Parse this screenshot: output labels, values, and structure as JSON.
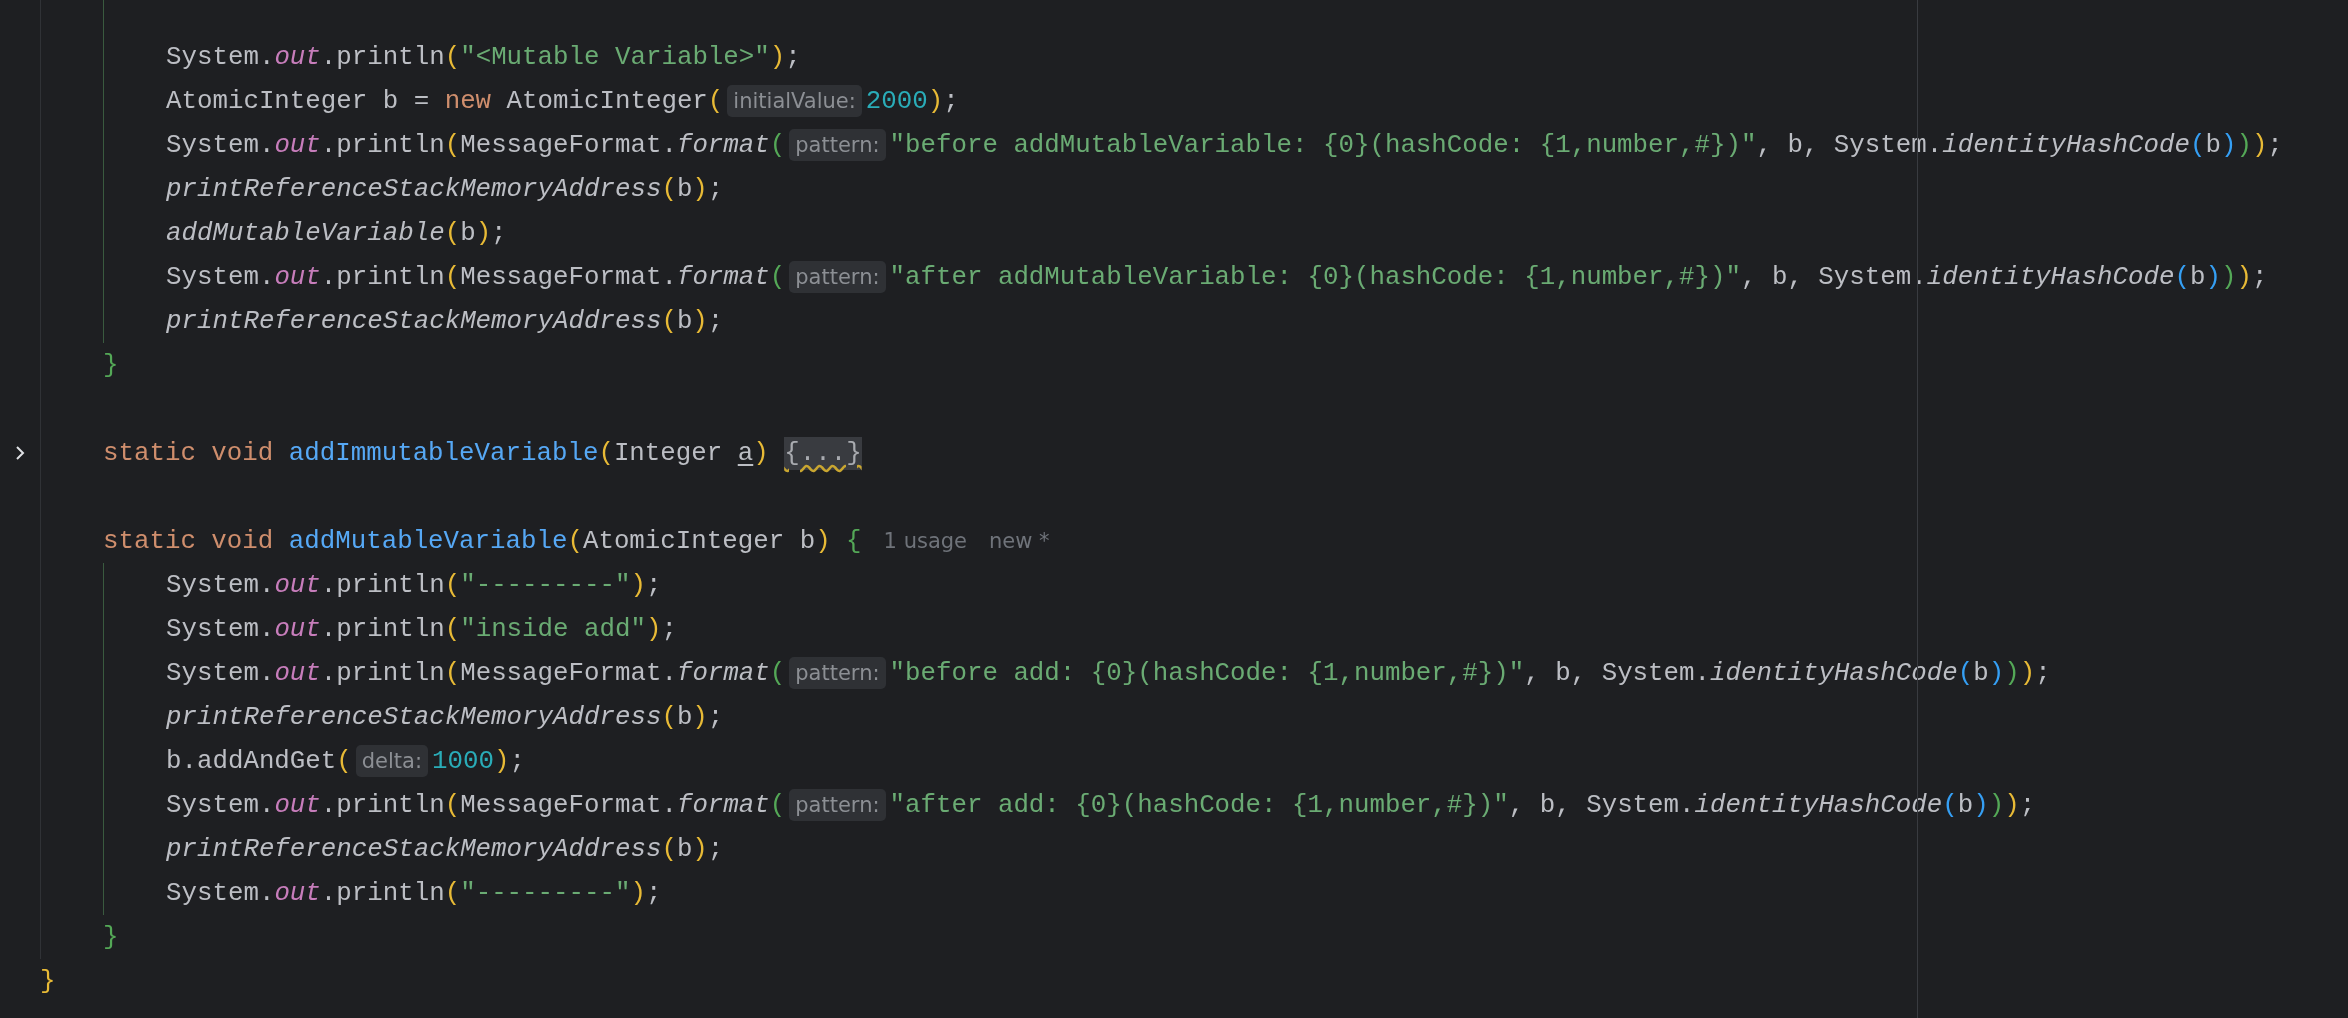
{
  "code": [
    {
      "children": [
        {
          "children": [
            {
              "tokens": [
                {
                  "kind": "plain",
                  "text": "System."
                },
                {
                  "kind": "field",
                  "text": "out"
                },
                {
                  "kind": "plain",
                  "text": ".println"
                },
                {
                  "kind": "bracket1",
                  "text": "("
                },
                {
                  "kind": "string",
                  "text": "\"<Mutable Variable>\""
                },
                {
                  "kind": "bracket1",
                  "text": ")"
                },
                {
                  "kind": "plain",
                  "text": ";"
                }
              ]
            },
            {
              "tokens": [
                {
                  "kind": "plain",
                  "text": "AtomicInteger b = "
                },
                {
                  "kind": "keyword",
                  "text": "new"
                },
                {
                  "kind": "plain",
                  "text": " AtomicInteger"
                },
                {
                  "kind": "bracket1",
                  "text": "("
                },
                {
                  "kind": "hint",
                  "text": "initialValue:"
                },
                {
                  "kind": "number",
                  "text": "2000"
                },
                {
                  "kind": "bracket1",
                  "text": ")"
                },
                {
                  "kind": "plain",
                  "text": ";"
                }
              ]
            },
            {
              "tokens": [
                {
                  "kind": "plain",
                  "text": "System."
                },
                {
                  "kind": "field",
                  "text": "out"
                },
                {
                  "kind": "plain",
                  "text": ".println"
                },
                {
                  "kind": "bracket1",
                  "text": "("
                },
                {
                  "kind": "plain",
                  "text": "MessageFormat."
                },
                {
                  "kind": "call",
                  "text": "format"
                },
                {
                  "kind": "bracket2",
                  "text": "("
                },
                {
                  "kind": "hint",
                  "text": "pattern:"
                },
                {
                  "kind": "string",
                  "text": "\"before addMutableVariable: {0}(hashCode: {1,number,#})\""
                },
                {
                  "kind": "plain",
                  "text": ", b, System."
                },
                {
                  "kind": "call",
                  "text": "identityHashCode"
                },
                {
                  "kind": "bracket3",
                  "text": "("
                },
                {
                  "kind": "plain",
                  "text": "b"
                },
                {
                  "kind": "bracket3",
                  "text": ")"
                },
                {
                  "kind": "bracket2",
                  "text": ")"
                },
                {
                  "kind": "bracket1",
                  "text": ")"
                },
                {
                  "kind": "plain",
                  "text": ";"
                }
              ]
            },
            {
              "tokens": [
                {
                  "kind": "call",
                  "text": "printReferenceStackMemoryAddress"
                },
                {
                  "kind": "bracket1",
                  "text": "("
                },
                {
                  "kind": "plain",
                  "text": "b"
                },
                {
                  "kind": "bracket1",
                  "text": ")"
                },
                {
                  "kind": "plain",
                  "text": ";"
                }
              ]
            },
            {
              "tokens": [
                {
                  "kind": "call",
                  "text": "addMutableVariable"
                },
                {
                  "kind": "bracket1",
                  "text": "("
                },
                {
                  "kind": "plain",
                  "text": "b"
                },
                {
                  "kind": "bracket1",
                  "text": ")"
                },
                {
                  "kind": "plain",
                  "text": ";"
                }
              ]
            },
            {
              "tokens": [
                {
                  "kind": "plain",
                  "text": "System."
                },
                {
                  "kind": "field",
                  "text": "out"
                },
                {
                  "kind": "plain",
                  "text": ".println"
                },
                {
                  "kind": "bracket1",
                  "text": "("
                },
                {
                  "kind": "plain",
                  "text": "MessageFormat."
                },
                {
                  "kind": "call",
                  "text": "format"
                },
                {
                  "kind": "bracket2",
                  "text": "("
                },
                {
                  "kind": "hint",
                  "text": "pattern:"
                },
                {
                  "kind": "string",
                  "text": "\"after addMutableVariable: {0}(hashCode: {1,number,#})\""
                },
                {
                  "kind": "plain",
                  "text": ", b, System."
                },
                {
                  "kind": "call",
                  "text": "identityHashCode"
                },
                {
                  "kind": "bracket3",
                  "text": "("
                },
                {
                  "kind": "plain",
                  "text": "b"
                },
                {
                  "kind": "bracket3",
                  "text": ")"
                },
                {
                  "kind": "bracket2",
                  "text": ")"
                },
                {
                  "kind": "bracket1",
                  "text": ")"
                },
                {
                  "kind": "plain",
                  "text": ";"
                }
              ]
            },
            {
              "tokens": [
                {
                  "kind": "call",
                  "text": "printReferenceStackMemoryAddress"
                },
                {
                  "kind": "bracket1",
                  "text": "("
                },
                {
                  "kind": "plain",
                  "text": "b"
                },
                {
                  "kind": "bracket1",
                  "text": ")"
                },
                {
                  "kind": "plain",
                  "text": ";"
                }
              ]
            }
          ]
        },
        {
          "tokens": [
            {
              "kind": "bracket2",
              "text": "}"
            }
          ]
        },
        {
          "kind": "blank"
        },
        {
          "folded": true,
          "tokens": [
            {
              "kind": "keyword",
              "text": "static void "
            },
            {
              "kind": "name",
              "text": "addImmutableVariable"
            },
            {
              "kind": "bracket1",
              "text": "("
            },
            {
              "kind": "plain",
              "text": "Integer "
            },
            {
              "kind": "param",
              "text": "a"
            },
            {
              "kind": "bracket1",
              "text": ") "
            },
            {
              "kind": "fold",
              "text": "{...}",
              "warning": true
            }
          ]
        },
        {
          "kind": "blank"
        },
        {
          "tokens": [
            {
              "kind": "keyword",
              "text": "static void "
            },
            {
              "kind": "name",
              "text": "addMutableVariable"
            },
            {
              "kind": "bracket1",
              "text": "("
            },
            {
              "kind": "plain",
              "text": "AtomicInteger b"
            },
            {
              "kind": "bracket1",
              "text": ") "
            },
            {
              "kind": "bracket2",
              "text": "{"
            },
            {
              "kind": "meta",
              "text": "1 usage"
            },
            {
              "kind": "meta",
              "text": "new *"
            }
          ],
          "children": [
            {
              "tokens": [
                {
                  "kind": "plain",
                  "text": "System."
                },
                {
                  "kind": "field",
                  "text": "out"
                },
                {
                  "kind": "plain",
                  "text": ".println"
                },
                {
                  "kind": "bracket1",
                  "text": "("
                },
                {
                  "kind": "string",
                  "text": "\"---------\""
                },
                {
                  "kind": "bracket1",
                  "text": ")"
                },
                {
                  "kind": "plain",
                  "text": ";"
                }
              ]
            },
            {
              "tokens": [
                {
                  "kind": "plain",
                  "text": "System."
                },
                {
                  "kind": "field",
                  "text": "out"
                },
                {
                  "kind": "plain",
                  "text": ".println"
                },
                {
                  "kind": "bracket1",
                  "text": "("
                },
                {
                  "kind": "string",
                  "text": "\"inside add\""
                },
                {
                  "kind": "bracket1",
                  "text": ")"
                },
                {
                  "kind": "plain",
                  "text": ";"
                }
              ]
            },
            {
              "tokens": [
                {
                  "kind": "plain",
                  "text": "System."
                },
                {
                  "kind": "field",
                  "text": "out"
                },
                {
                  "kind": "plain",
                  "text": ".println"
                },
                {
                  "kind": "bracket1",
                  "text": "("
                },
                {
                  "kind": "plain",
                  "text": "MessageFormat."
                },
                {
                  "kind": "call",
                  "text": "format"
                },
                {
                  "kind": "bracket2",
                  "text": "("
                },
                {
                  "kind": "hint",
                  "text": "pattern:"
                },
                {
                  "kind": "string",
                  "text": "\"before add: {0}(hashCode: {1,number,#})\""
                },
                {
                  "kind": "plain",
                  "text": ", b, System."
                },
                {
                  "kind": "call",
                  "text": "identityHashCode"
                },
                {
                  "kind": "bracket3",
                  "text": "("
                },
                {
                  "kind": "plain",
                  "text": "b"
                },
                {
                  "kind": "bracket3",
                  "text": ")"
                },
                {
                  "kind": "bracket2",
                  "text": ")"
                },
                {
                  "kind": "bracket1",
                  "text": ")"
                },
                {
                  "kind": "plain",
                  "text": ";"
                }
              ]
            },
            {
              "tokens": [
                {
                  "kind": "call",
                  "text": "printReferenceStackMemoryAddress"
                },
                {
                  "kind": "bracket1",
                  "text": "("
                },
                {
                  "kind": "plain",
                  "text": "b"
                },
                {
                  "kind": "bracket1",
                  "text": ")"
                },
                {
                  "kind": "plain",
                  "text": ";"
                }
              ]
            },
            {
              "tokens": [
                {
                  "kind": "plain",
                  "text": "b.addAndGet"
                },
                {
                  "kind": "bracket1",
                  "text": "("
                },
                {
                  "kind": "hint",
                  "text": "delta:"
                },
                {
                  "kind": "number",
                  "text": "1000"
                },
                {
                  "kind": "bracket1",
                  "text": ")"
                },
                {
                  "kind": "plain",
                  "text": ";"
                }
              ]
            },
            {
              "tokens": [
                {
                  "kind": "plain",
                  "text": "System."
                },
                {
                  "kind": "field",
                  "text": "out"
                },
                {
                  "kind": "plain",
                  "text": ".println"
                },
                {
                  "kind": "bracket1",
                  "text": "("
                },
                {
                  "kind": "plain",
                  "text": "MessageFormat."
                },
                {
                  "kind": "call",
                  "text": "format"
                },
                {
                  "kind": "bracket2",
                  "text": "("
                },
                {
                  "kind": "hint",
                  "text": "pattern:"
                },
                {
                  "kind": "string",
                  "text": "\"after add: {0}(hashCode: {1,number,#})\""
                },
                {
                  "kind": "plain",
                  "text": ", b, System."
                },
                {
                  "kind": "call",
                  "text": "identityHashCode"
                },
                {
                  "kind": "bracket3",
                  "text": "("
                },
                {
                  "kind": "plain",
                  "text": "b"
                },
                {
                  "kind": "bracket3",
                  "text": ")"
                },
                {
                  "kind": "bracket2",
                  "text": ")"
                },
                {
                  "kind": "bracket1",
                  "text": ")"
                },
                {
                  "kind": "plain",
                  "text": ";"
                }
              ]
            },
            {
              "tokens": [
                {
                  "kind": "call",
                  "text": "printReferenceStackMemoryAddress"
                },
                {
                  "kind": "bracket1",
                  "text": "("
                },
                {
                  "kind": "plain",
                  "text": "b"
                },
                {
                  "kind": "bracket1",
                  "text": ")"
                },
                {
                  "kind": "plain",
                  "text": ";"
                }
              ]
            },
            {
              "tokens": [
                {
                  "kind": "plain",
                  "text": "System."
                },
                {
                  "kind": "field",
                  "text": "out"
                },
                {
                  "kind": "plain",
                  "text": ".println"
                },
                {
                  "kind": "bracket1",
                  "text": "("
                },
                {
                  "kind": "string",
                  "text": "\"---------\""
                },
                {
                  "kind": "bracket1",
                  "text": ")"
                },
                {
                  "kind": "plain",
                  "text": ";"
                }
              ]
            }
          ]
        },
        {
          "tokens": [
            {
              "kind": "bracket2",
              "text": "}"
            }
          ]
        }
      ]
    },
    {
      "tokens": [
        {
          "kind": "bracket1",
          "text": "}"
        }
      ]
    }
  ]
}
